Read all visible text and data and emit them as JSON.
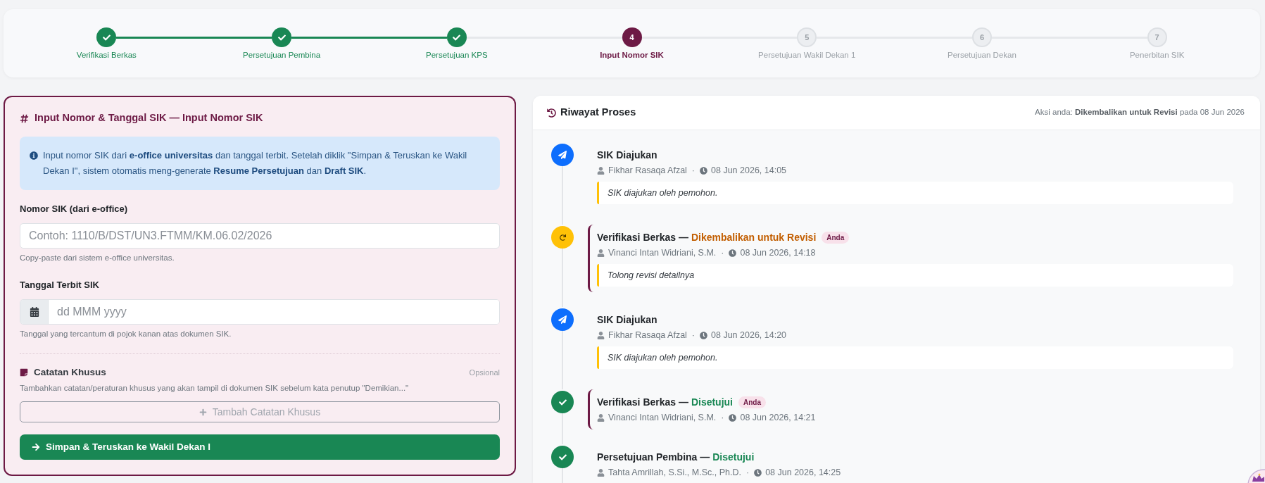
{
  "stepper": {
    "steps": [
      {
        "label": "Verifikasi Berkas",
        "completed": true,
        "selected": false
      },
      {
        "label": "Persetujuan Pembina",
        "completed": true,
        "selected": false
      },
      {
        "label": "Persetujuan KPS",
        "completed": true,
        "selected": false
      },
      {
        "number": "4",
        "label": "Input Nomor SIK",
        "completed": false,
        "selected": true
      },
      {
        "number": "5",
        "label": "Persetujuan Wakil Dekan 1",
        "completed": false,
        "selected": false
      },
      {
        "number": "6",
        "label": "Persetujuan Dekan",
        "completed": false,
        "selected": false
      },
      {
        "number": "7",
        "label": "Penerbitan SIK",
        "completed": false,
        "selected": false
      }
    ]
  },
  "form": {
    "title": "Input Nomor & Tanggal SIK — Input Nomor SIK",
    "info": "Input nomor SIK dari **e-office universitas** dan tanggal terbit. Setelah diklik \"Simpan & Teruskan ke Wakil Dekan I\", sistem otomatis meng-generate **Resume Persetujuan** dan **Draft SIK**.",
    "fields": [
      {
        "kind": "text",
        "label": "Nomor SIK (dari e-office)",
        "placeholder": "Contoh: 1110/B/DST/UN3.FTMM/KM.06.02/2026",
        "help": "Copy-paste dari sistem e-office universitas."
      },
      {
        "kind": "date",
        "label": "Tanggal Terbit SIK",
        "placeholder": "dd MMM yyyy",
        "help": "Tanggal yang tercantum di pojok kanan atas dokumen SIK."
      }
    ],
    "notes": {
      "title": "Catatan Khusus",
      "optional": "Opsional",
      "description": "Tambahkan catatan/peraturan khusus yang akan tampil di dokumen SIK sebelum kata penutup \"Demikian...\"",
      "add_button": "Tambah Catatan Khusus"
    },
    "submit_button": "Simpan & Teruskan ke Wakil Dekan I"
  },
  "history": {
    "title": "Riwayat Proses",
    "summary": "Aksi anda: **Dikembalikan untuk Revisi** pada 08 Jun 2026",
    "entries": [
      {
        "kind": "submitted",
        "title": "SIK Diajukan",
        "actor": "Fikhar Rasaqa Afzal",
        "separator": "·",
        "time": "08 Jun 2026, 14:05",
        "note": "SIK diajukan oleh pemohon.",
        "mine": false
      },
      {
        "kind": "returned",
        "title": "Verifikasi Berkas —",
        "result": "Dikembalikan untuk Revisi",
        "tag": "Anda",
        "actor": "Vinanci Intan Widriani, S.M.",
        "separator": "·",
        "time": "08 Jun 2026, 14:18",
        "note": "Tolong revisi detailnya",
        "mine": true
      },
      {
        "kind": "submitted",
        "title": "SIK Diajukan",
        "actor": "Fikhar Rasaqa Afzal",
        "separator": "·",
        "time": "08 Jun 2026, 14:20",
        "note": "SIK diajukan oleh pemohon.",
        "mine": false
      },
      {
        "kind": "approved",
        "title": "Verifikasi Berkas —",
        "result": "Disetujui",
        "tag": "Anda",
        "actor": "Vinanci Intan Widriani, S.M.",
        "separator": "·",
        "time": "08 Jun 2026, 14:21",
        "mine": true
      },
      {
        "kind": "approved",
        "title": "Persetujuan Pembina —",
        "result": "Disetujui",
        "actor": "Tahta Amrillah, S.Si., M.Sc., Ph.D.",
        "separator": "·",
        "time": "08 Jun 2026, 14:25",
        "mine": false
      }
    ]
  }
}
